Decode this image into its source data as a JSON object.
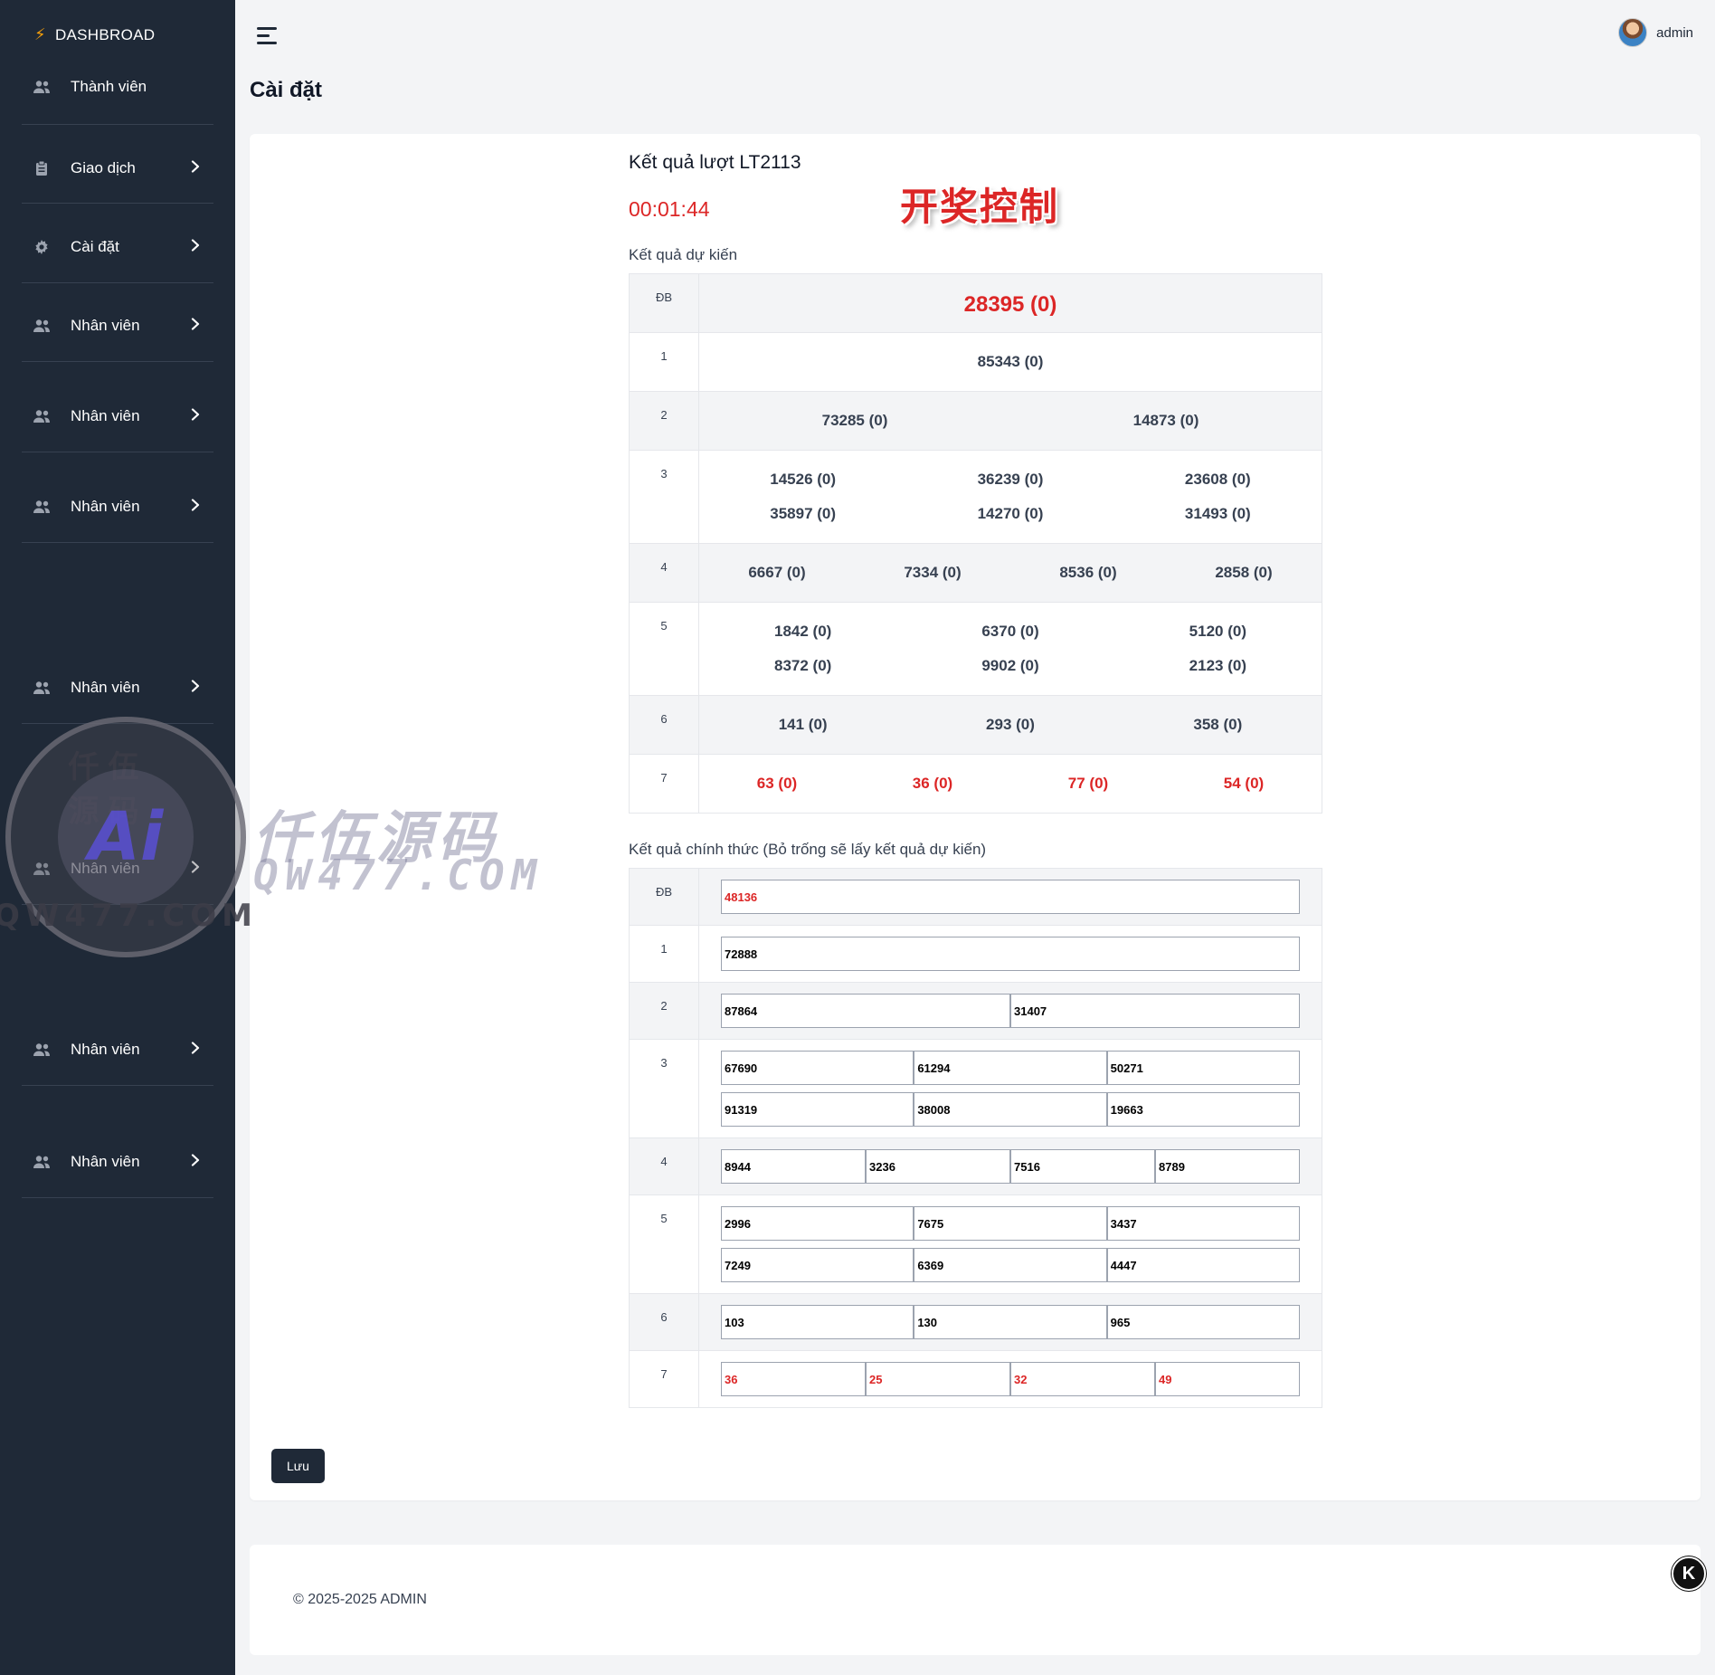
{
  "sidebar": {
    "brand": "DASHBROAD",
    "items": [
      {
        "label": "Thành viên",
        "icon": "users-icon",
        "chevron": false
      },
      {
        "label": "Giao dịch",
        "icon": "clipboard-icon",
        "chevron": true
      },
      {
        "label": "Cài đặt",
        "icon": "gear-icon",
        "chevron": true
      },
      {
        "label": "Nhân viên",
        "icon": "users-icon",
        "chevron": true
      },
      {
        "label": "Nhân viên",
        "icon": "users-icon",
        "chevron": true
      },
      {
        "label": "Nhân viên",
        "icon": "users-icon",
        "chevron": true
      },
      {
        "label": "Nhân viên",
        "icon": "users-icon",
        "chevron": true
      },
      {
        "label": "Nhân viên",
        "icon": "users-icon",
        "chevron": true
      },
      {
        "label": "Nhân viên",
        "icon": "users-icon",
        "chevron": true
      },
      {
        "label": "Nhân viên",
        "icon": "users-icon",
        "chevron": true
      }
    ]
  },
  "header": {
    "user_name": "admin"
  },
  "page": {
    "title": "Cài đặt"
  },
  "round": {
    "title": "Kết quả lượt LT2113",
    "timer": "00:01:44"
  },
  "overlay_label": "开奖控制",
  "expected": {
    "label": "Kết quả dự kiến",
    "rows": [
      {
        "prize": "ĐB",
        "values": [
          "28395 (0)"
        ],
        "cols": 1,
        "style": "big"
      },
      {
        "prize": "1",
        "values": [
          "85343 (0)"
        ],
        "cols": 1
      },
      {
        "prize": "2",
        "values": [
          "73285 (0)",
          "14873 (0)"
        ],
        "cols": 2
      },
      {
        "prize": "3",
        "values": [
          "14526 (0)",
          "36239 (0)",
          "23608 (0)",
          "35897 (0)",
          "14270 (0)",
          "31493 (0)"
        ],
        "cols": 3
      },
      {
        "prize": "4",
        "values": [
          "6667 (0)",
          "7334 (0)",
          "8536 (0)",
          "2858 (0)"
        ],
        "cols": 4
      },
      {
        "prize": "5",
        "values": [
          "1842 (0)",
          "6370 (0)",
          "5120 (0)",
          "8372 (0)",
          "9902 (0)",
          "2123 (0)"
        ],
        "cols": 3
      },
      {
        "prize": "6",
        "values": [
          "141 (0)",
          "293 (0)",
          "358 (0)"
        ],
        "cols": 3
      },
      {
        "prize": "7",
        "values": [
          "63 (0)",
          "36 (0)",
          "77 (0)",
          "54 (0)"
        ],
        "cols": 4,
        "style": "red"
      }
    ]
  },
  "official": {
    "label": "Kết quả chính thức (Bỏ trống sẽ lấy kết quả dự kiến)",
    "rows": [
      {
        "prize": "ĐB",
        "values": [
          "48136"
        ],
        "cols": 1,
        "style": "red"
      },
      {
        "prize": "1",
        "values": [
          "72888"
        ],
        "cols": 1
      },
      {
        "prize": "2",
        "values": [
          "87864",
          "31407"
        ],
        "cols": 2
      },
      {
        "prize": "3",
        "values": [
          "67690",
          "61294",
          "50271",
          "91319",
          "38008",
          "19663"
        ],
        "cols": 3
      },
      {
        "prize": "4",
        "values": [
          "8944",
          "3236",
          "7516",
          "8789"
        ],
        "cols": 4
      },
      {
        "prize": "5",
        "values": [
          "2996",
          "7675",
          "3437",
          "7249",
          "6369",
          "4447"
        ],
        "cols": 3
      },
      {
        "prize": "6",
        "values": [
          "103",
          "130",
          "965"
        ],
        "cols": 3
      },
      {
        "prize": "7",
        "values": [
          "36",
          "25",
          "32",
          "49"
        ],
        "cols": 4,
        "style": "red"
      }
    ]
  },
  "actions": {
    "save_label": "Lưu"
  },
  "footer": {
    "copyright": "© 2025-2025 ADMIN"
  },
  "badge": {
    "letter": "K"
  },
  "watermark": {
    "seal_top": "仟伍源码",
    "seal_center": "Ai",
    "seal_bottom": "QW477.COM",
    "text": "仟伍源码",
    "url": "QW477.COM"
  },
  "colors": {
    "sidebar_bg": "#1f2937",
    "accent_red": "#dc2626",
    "bolt": "#f59e0b"
  }
}
